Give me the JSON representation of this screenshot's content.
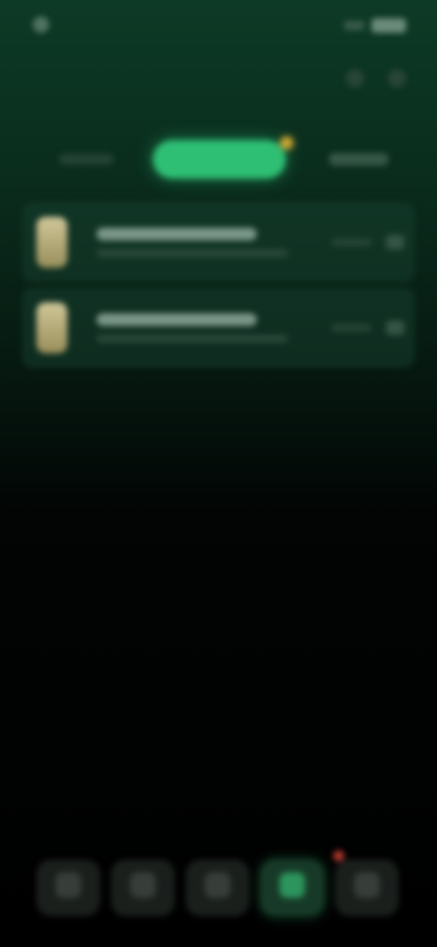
{
  "status_bar": {
    "time": "",
    "icons": [
      "app-indicator-icon",
      "signal-icon",
      "wifi-icon",
      "battery-icon"
    ]
  },
  "header": {
    "title": "",
    "actions": [
      "search-icon",
      "more-icon"
    ]
  },
  "tabs": [
    {
      "label": "",
      "active": false
    },
    {
      "label": "",
      "active": true
    },
    {
      "label": "",
      "active": false
    }
  ],
  "list": [
    {
      "title": "",
      "subtitle": "",
      "meta": ""
    },
    {
      "title": "",
      "subtitle": "",
      "meta": ""
    }
  ],
  "bottom_nav": [
    {
      "icon": "home-icon",
      "active": false
    },
    {
      "icon": "explore-icon",
      "active": false
    },
    {
      "icon": "play-icon",
      "active": false
    },
    {
      "icon": "library-icon",
      "active": true
    },
    {
      "icon": "profile-icon",
      "active": false
    }
  ],
  "colors": {
    "accent": "#2ebf74",
    "background_top": "#0d3a26",
    "background_bottom": "#000000",
    "badge": "#c9a534",
    "nav_badge": "#b23a2f"
  }
}
